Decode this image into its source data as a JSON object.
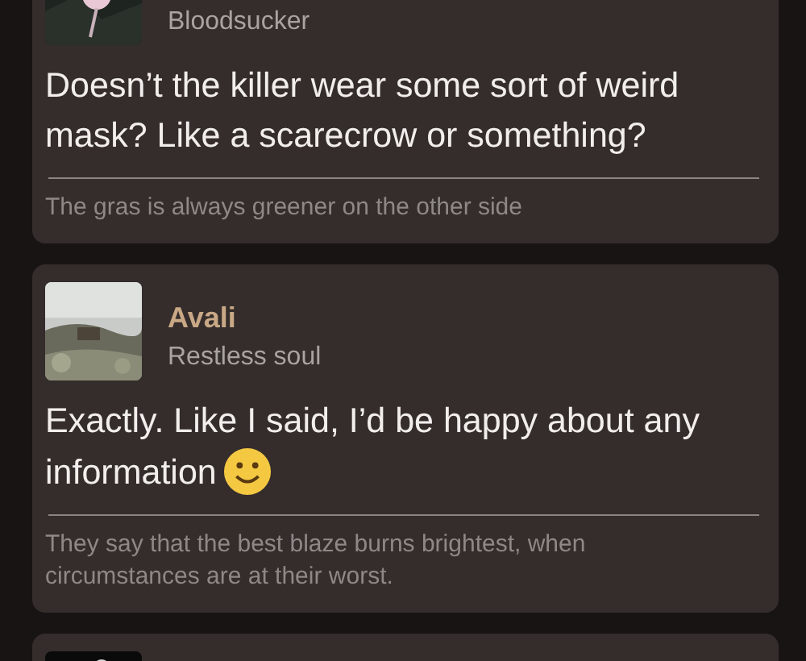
{
  "posts": [
    {
      "avatar": {
        "kind": "picture"
      },
      "role": "Bloodsucker",
      "message": "Doesn’t the killer wear some sort of weird mask? Like a scarecrow or something?",
      "emoji": false,
      "signature": "The gras is always greener on the other side"
    },
    {
      "avatar": {
        "kind": "picture"
      },
      "name": "Avali",
      "role": "Restless soul",
      "message": "Exactly. Like I said, I’d be happy about any information",
      "emoji": true,
      "signature": "They say that the best blaze burns brightest, when circumstances are at their worst."
    },
    {
      "avatar": {
        "kind": "picture"
      }
    }
  ]
}
